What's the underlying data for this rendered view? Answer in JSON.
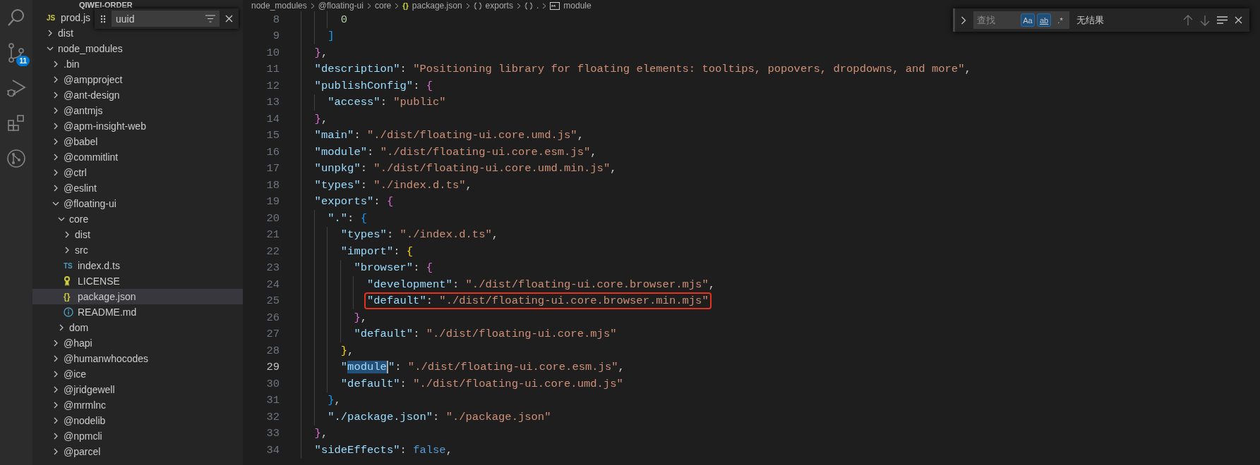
{
  "activity_bar": [
    {
      "kind": "search"
    },
    {
      "kind": "source-control",
      "badge": "11"
    },
    {
      "kind": "run-debug"
    },
    {
      "kind": "extensions"
    },
    {
      "kind": "git-graph"
    }
  ],
  "explorer": {
    "title": "QIWEI-ORDER",
    "items": [
      {
        "kind": "js",
        "label": "prod.js",
        "icon_text": "JS",
        "selected": false
      },
      {
        "kind": "folder",
        "label": "dist",
        "expanded": false,
        "selected": false
      },
      {
        "kind": "folder",
        "label": "node_modules",
        "expanded": true,
        "selected": false,
        "children": [
          {
            "kind": "folder",
            "label": ".bin",
            "expanded": false,
            "selected": false
          },
          {
            "kind": "folder",
            "label": "@ampproject",
            "expanded": false,
            "selected": false
          },
          {
            "kind": "folder",
            "label": "@ant-design",
            "expanded": false,
            "selected": false
          },
          {
            "kind": "folder",
            "label": "@antmjs",
            "expanded": false,
            "selected": false
          },
          {
            "kind": "folder",
            "label": "@apm-insight-web",
            "expanded": false,
            "selected": false
          },
          {
            "kind": "folder",
            "label": "@babel",
            "expanded": false,
            "selected": false
          },
          {
            "kind": "folder",
            "label": "@commitlint",
            "expanded": false,
            "selected": false
          },
          {
            "kind": "folder",
            "label": "@ctrl",
            "expanded": false,
            "selected": false
          },
          {
            "kind": "folder",
            "label": "@eslint",
            "expanded": false,
            "selected": false
          },
          {
            "kind": "folder",
            "label": "@floating-ui",
            "expanded": true,
            "selected": false,
            "children": [
              {
                "kind": "folder",
                "label": "core",
                "expanded": true,
                "selected": false,
                "children": [
                  {
                    "kind": "folder",
                    "label": "dist",
                    "expanded": false,
                    "selected": false
                  },
                  {
                    "kind": "folder",
                    "label": "src",
                    "expanded": false,
                    "selected": false
                  },
                  {
                    "kind": "ts",
                    "label": "index.d.ts",
                    "icon_text": "TS",
                    "selected": false
                  },
                  {
                    "kind": "license",
                    "label": "LICENSE",
                    "selected": false
                  },
                  {
                    "kind": "json",
                    "label": "package.json",
                    "icon_text": "{}",
                    "selected": true
                  },
                  {
                    "kind": "info",
                    "label": "README.md",
                    "selected": false
                  }
                ]
              },
              {
                "kind": "folder",
                "label": "dom",
                "expanded": false,
                "selected": false
              }
            ]
          },
          {
            "kind": "folder",
            "label": "@hapi",
            "expanded": false,
            "selected": false
          },
          {
            "kind": "folder",
            "label": "@humanwhocodes",
            "expanded": false,
            "selected": false
          },
          {
            "kind": "folder",
            "label": "@ice",
            "expanded": false,
            "selected": false
          },
          {
            "kind": "folder",
            "label": "@jridgewell",
            "expanded": false,
            "selected": false
          },
          {
            "kind": "folder",
            "label": "@mrmlnc",
            "expanded": false,
            "selected": false
          },
          {
            "kind": "folder",
            "label": "@nodelib",
            "expanded": false,
            "selected": false
          },
          {
            "kind": "folder",
            "label": "@npmcli",
            "expanded": false,
            "selected": false
          },
          {
            "kind": "folder",
            "label": "@parcel",
            "expanded": false,
            "selected": false
          }
        ]
      }
    ]
  },
  "tree_filter": {
    "value": "uuid"
  },
  "breadcrumb": [
    {
      "kind": "folder",
      "label": "node_modules"
    },
    {
      "kind": "folder",
      "label": "@floating-ui"
    },
    {
      "kind": "folder",
      "label": "core"
    },
    {
      "kind": "file",
      "label": "package.json",
      "icon_text": "{}"
    },
    {
      "kind": "object",
      "label": "exports"
    },
    {
      "kind": "object",
      "label": "."
    },
    {
      "kind": "field",
      "label": "module"
    }
  ],
  "editor": {
    "lines": [
      {
        "number": "8",
        "current": false,
        "boxed": false,
        "tokens": [
          {
            "kind": "number",
            "text": "0"
          }
        ]
      },
      {
        "number": "9",
        "current": false,
        "boxed": false,
        "tokens": [
          {
            "kind": "brace",
            "text": "]",
            "color": "#179fff"
          }
        ]
      },
      {
        "number": "10",
        "current": false,
        "boxed": false,
        "tokens": [
          {
            "kind": "brace",
            "text": "}",
            "color": "#da70d6"
          },
          {
            "kind": "punct",
            "text": ","
          }
        ]
      },
      {
        "number": "11",
        "current": false,
        "boxed": false,
        "tokens": [
          {
            "kind": "key",
            "text": "\"description\""
          },
          {
            "kind": "punct",
            "text": ": "
          },
          {
            "kind": "string",
            "text": "\"Positioning library for floating elements: tooltips, popovers, dropdowns, and more\""
          },
          {
            "kind": "punct",
            "text": ","
          }
        ]
      },
      {
        "number": "12",
        "current": false,
        "boxed": false,
        "tokens": [
          {
            "kind": "key",
            "text": "\"publishConfig\""
          },
          {
            "kind": "punct",
            "text": ": "
          },
          {
            "kind": "brace",
            "text": "{",
            "color": "#da70d6"
          }
        ]
      },
      {
        "number": "13",
        "current": false,
        "boxed": false,
        "tokens": [
          {
            "kind": "key",
            "text": "\"access\""
          },
          {
            "kind": "punct",
            "text": ": "
          },
          {
            "kind": "string",
            "text": "\"public\""
          }
        ]
      },
      {
        "number": "14",
        "current": false,
        "boxed": false,
        "tokens": [
          {
            "kind": "brace",
            "text": "}",
            "color": "#da70d6"
          },
          {
            "kind": "punct",
            "text": ","
          }
        ]
      },
      {
        "number": "15",
        "current": false,
        "boxed": false,
        "tokens": [
          {
            "kind": "key",
            "text": "\"main\""
          },
          {
            "kind": "punct",
            "text": ": "
          },
          {
            "kind": "string",
            "text": "\"./dist/floating-ui.core.umd.js\""
          },
          {
            "kind": "punct",
            "text": ","
          }
        ]
      },
      {
        "number": "16",
        "current": false,
        "boxed": false,
        "tokens": [
          {
            "kind": "key",
            "text": "\"module\""
          },
          {
            "kind": "punct",
            "text": ": "
          },
          {
            "kind": "string",
            "text": "\"./dist/floating-ui.core.esm.js\""
          },
          {
            "kind": "punct",
            "text": ","
          }
        ]
      },
      {
        "number": "17",
        "current": false,
        "boxed": false,
        "tokens": [
          {
            "kind": "key",
            "text": "\"unpkg\""
          },
          {
            "kind": "punct",
            "text": ": "
          },
          {
            "kind": "string",
            "text": "\"./dist/floating-ui.core.umd.min.js\""
          },
          {
            "kind": "punct",
            "text": ","
          }
        ]
      },
      {
        "number": "18",
        "current": false,
        "boxed": false,
        "tokens": [
          {
            "kind": "key",
            "text": "\"types\""
          },
          {
            "kind": "punct",
            "text": ": "
          },
          {
            "kind": "string",
            "text": "\"./index.d.ts\""
          },
          {
            "kind": "punct",
            "text": ","
          }
        ]
      },
      {
        "number": "19",
        "current": false,
        "boxed": false,
        "tokens": [
          {
            "kind": "key",
            "text": "\"exports\""
          },
          {
            "kind": "punct",
            "text": ": "
          },
          {
            "kind": "brace",
            "text": "{",
            "color": "#da70d6"
          }
        ]
      },
      {
        "number": "20",
        "current": false,
        "boxed": false,
        "tokens": [
          {
            "kind": "key",
            "text": "\".\""
          },
          {
            "kind": "punct",
            "text": ": "
          },
          {
            "kind": "brace",
            "text": "{",
            "color": "#179fff"
          }
        ]
      },
      {
        "number": "21",
        "current": false,
        "boxed": false,
        "tokens": [
          {
            "kind": "key",
            "text": "\"types\""
          },
          {
            "kind": "punct",
            "text": ": "
          },
          {
            "kind": "string",
            "text": "\"./index.d.ts\""
          },
          {
            "kind": "punct",
            "text": ","
          }
        ]
      },
      {
        "number": "22",
        "current": false,
        "boxed": false,
        "tokens": [
          {
            "kind": "key",
            "text": "\"import\""
          },
          {
            "kind": "punct",
            "text": ": "
          },
          {
            "kind": "brace",
            "text": "{",
            "color": "#ffd700"
          }
        ]
      },
      {
        "number": "23",
        "current": false,
        "boxed": false,
        "tokens": [
          {
            "kind": "key",
            "text": "\"browser\""
          },
          {
            "kind": "punct",
            "text": ": "
          },
          {
            "kind": "brace",
            "text": "{",
            "color": "#da70d6"
          }
        ]
      },
      {
        "number": "24",
        "current": false,
        "boxed": false,
        "tokens": [
          {
            "kind": "key",
            "text": "\"development\""
          },
          {
            "kind": "punct",
            "text": ": "
          },
          {
            "kind": "string",
            "text": "\"./dist/floating-ui.core.browser.mjs\""
          },
          {
            "kind": "punct",
            "text": ","
          }
        ]
      },
      {
        "number": "25",
        "current": false,
        "boxed": true,
        "tokens": [
          {
            "kind": "key",
            "text": "\"default\""
          },
          {
            "kind": "punct",
            "text": ": "
          },
          {
            "kind": "string",
            "text": "\"./dist/floating-ui.core.browser.min.mjs\""
          }
        ]
      },
      {
        "number": "26",
        "current": false,
        "boxed": false,
        "tokens": [
          {
            "kind": "brace",
            "text": "}",
            "color": "#da70d6"
          },
          {
            "kind": "punct",
            "text": ","
          }
        ]
      },
      {
        "number": "27",
        "current": false,
        "boxed": false,
        "tokens": [
          {
            "kind": "key",
            "text": "\"default\""
          },
          {
            "kind": "punct",
            "text": ": "
          },
          {
            "kind": "string",
            "text": "\"./dist/floating-ui.core.mjs\""
          }
        ]
      },
      {
        "number": "28",
        "current": false,
        "boxed": false,
        "tokens": [
          {
            "kind": "brace",
            "text": "}",
            "color": "#ffd700"
          },
          {
            "kind": "punct",
            "text": ","
          }
        ]
      },
      {
        "number": "29",
        "current": true,
        "boxed": false,
        "tokens": [
          {
            "kind": "key",
            "text": "\""
          },
          {
            "kind": "match",
            "text": "module"
          },
          {
            "kind": "key",
            "text": "\""
          },
          {
            "kind": "punct",
            "text": ": "
          },
          {
            "kind": "string",
            "text": "\"./dist/floating-ui.core.esm.js\""
          },
          {
            "kind": "punct",
            "text": ","
          }
        ]
      },
      {
        "number": "30",
        "current": false,
        "boxed": false,
        "tokens": [
          {
            "kind": "key",
            "text": "\"default\""
          },
          {
            "kind": "punct",
            "text": ": "
          },
          {
            "kind": "string",
            "text": "\"./dist/floating-ui.core.umd.js\""
          }
        ]
      },
      {
        "number": "31",
        "current": false,
        "boxed": false,
        "tokens": [
          {
            "kind": "brace",
            "text": "}",
            "color": "#179fff"
          },
          {
            "kind": "punct",
            "text": ","
          }
        ]
      },
      {
        "number": "32",
        "current": false,
        "boxed": false,
        "tokens": [
          {
            "kind": "key",
            "text": "\"./package.json\""
          },
          {
            "kind": "punct",
            "text": ": "
          },
          {
            "kind": "string",
            "text": "\"./package.json\""
          }
        ]
      },
      {
        "number": "33",
        "current": false,
        "boxed": false,
        "tokens": [
          {
            "kind": "brace",
            "text": "}",
            "color": "#da70d6"
          },
          {
            "kind": "punct",
            "text": ","
          }
        ]
      },
      {
        "number": "34",
        "current": false,
        "boxed": false,
        "tokens": [
          {
            "kind": "key",
            "text": "\"sideEffects\""
          },
          {
            "kind": "punct",
            "text": ": "
          },
          {
            "kind": "bool",
            "text": "false"
          },
          {
            "kind": "punct",
            "text": ","
          }
        ]
      }
    ]
  },
  "find_widget": {
    "placeholder": "查找",
    "toggles": [
      {
        "kind": "case",
        "label": "Aa",
        "on": true
      },
      {
        "kind": "word",
        "label": "ab",
        "on": true
      },
      {
        "kind": "regex",
        "label": ".*",
        "on": false
      }
    ],
    "result": "无结果"
  }
}
